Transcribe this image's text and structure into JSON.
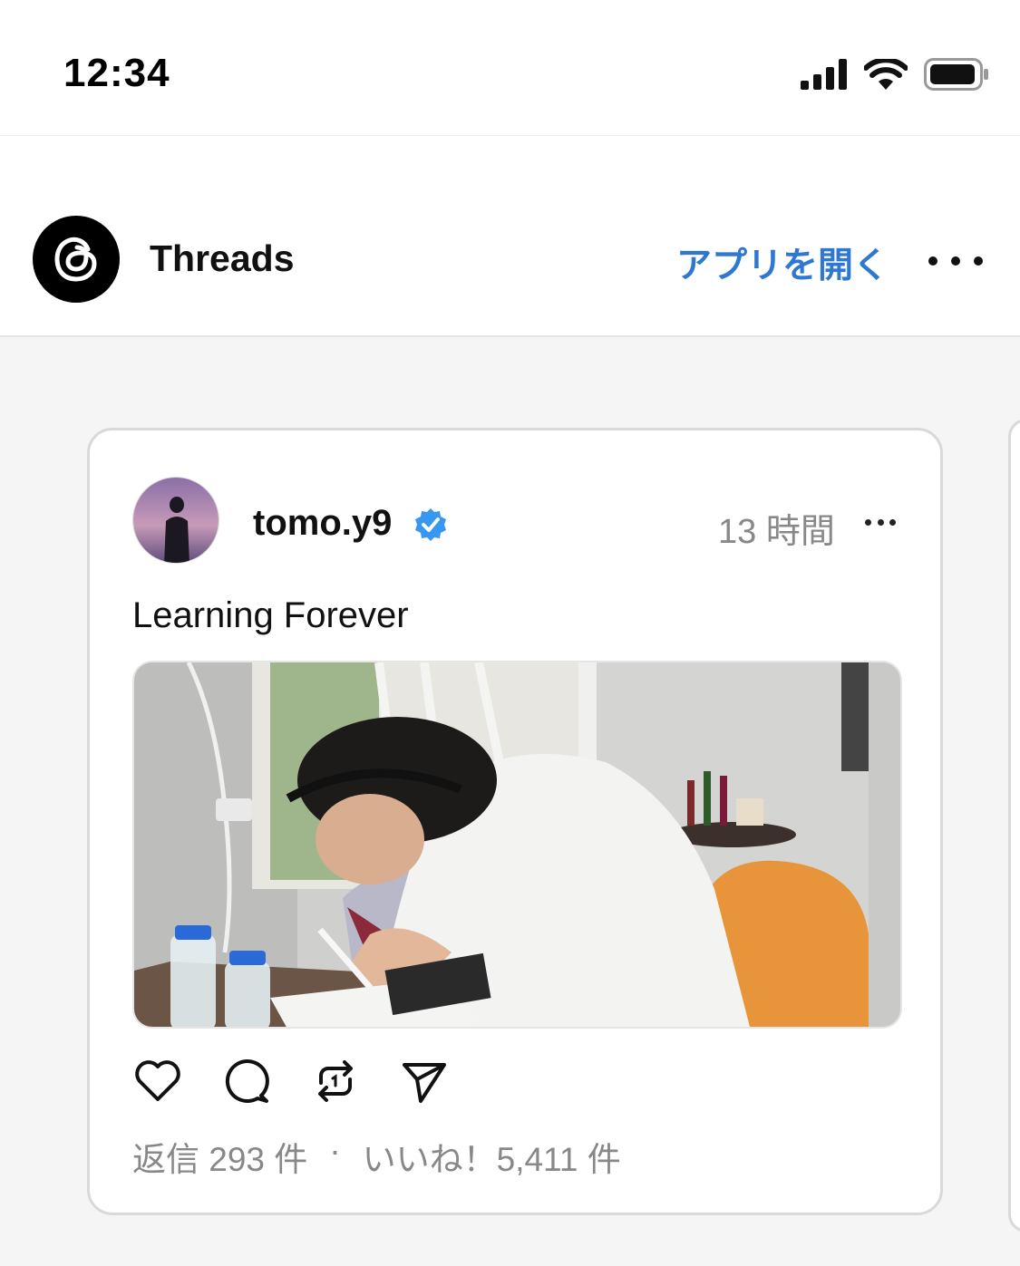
{
  "status_bar": {
    "time": "12:34",
    "icons": [
      "signal-icon",
      "wifi-icon",
      "battery-icon"
    ]
  },
  "header": {
    "app_name": "Threads",
    "open_app_label": "アプリを開く",
    "accent_color": "#2f78d2"
  },
  "post": {
    "username": "tomo.y9",
    "verified": true,
    "time_ago": "13 時間",
    "text": "Learning Forever",
    "actions": [
      "like-icon",
      "reply-icon",
      "repost-icon",
      "share-icon"
    ],
    "replies": "返信 293 件",
    "separator": "·",
    "likes": "いいね！5,411 件"
  }
}
